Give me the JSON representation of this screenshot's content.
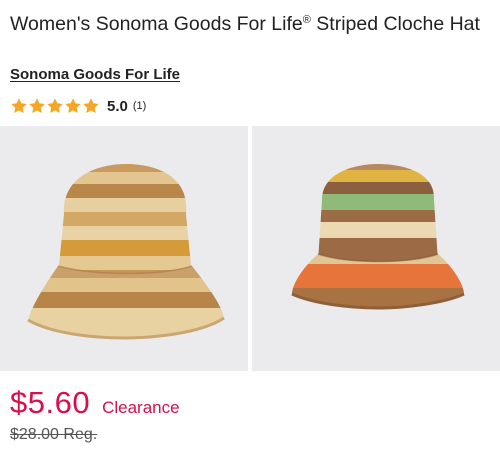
{
  "product": {
    "title": "Women's Sonoma Goods For Life",
    "registered_mark": "®",
    "title_rest": " Striped Cloche Hat",
    "brand": "Sonoma Goods For Life"
  },
  "rating": {
    "value": "5.0",
    "count": "(1)",
    "stars": 5,
    "star_color": "#f5a623"
  },
  "gallery": {
    "images": [
      {
        "icon": "straw-bucket-hat-tan-stripes"
      },
      {
        "icon": "straw-bucket-hat-multicolor-stripes"
      }
    ],
    "background": "#ebebed"
  },
  "pricing": {
    "sale_price": "$5.60",
    "sale_label": "Clearance",
    "regular_price": "$28.00 Reg.",
    "sale_color": "#d5104b"
  }
}
